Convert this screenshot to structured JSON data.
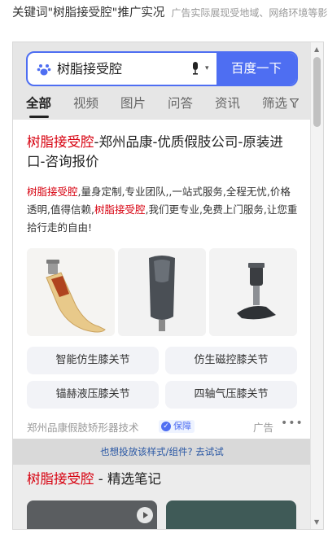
{
  "page": {
    "heading": "关键词\"树脂接受腔\"推广实况",
    "subheading": "广告实际展现受地域、网络环境等影响"
  },
  "search": {
    "query": "树脂接受腔",
    "button_label": "百度一下",
    "icon": "baidu-paw-icon"
  },
  "tabs": [
    {
      "label": "全部",
      "active": true
    },
    {
      "label": "视频"
    },
    {
      "label": "图片"
    },
    {
      "label": "问答"
    },
    {
      "label": "资讯"
    },
    {
      "label": "筛选"
    }
  ],
  "ad": {
    "title_highlight": "树脂接受腔",
    "title_rest": "-郑州品康-优质假肢公司-原装进口-咨询报价",
    "desc_hl1": "树脂接受腔",
    "desc_part1": ",量身定制,专业团队,,一站式服务,全程无忧,价格透明,值得信赖,",
    "desc_hl2": "树脂接受腔",
    "desc_part2": ",我们更专业,免费上门服务,让您重拾行走的自由!",
    "images": [
      "prosthetic-foot-image",
      "prosthetic-socket-image",
      "prosthetic-knee-foot-image"
    ],
    "chips": [
      "智能仿生膝关节",
      "仿生磁控膝关节",
      "锚赫液压膝关节",
      "四轴气压膝关节"
    ],
    "source": "郑州品康假肢矫形器技术",
    "verified_label": "保障",
    "ad_label": "广告",
    "more": "•••"
  },
  "promo": {
    "text": "也想投放该样式/组件? 去试试"
  },
  "notes": {
    "title_highlight": "树脂接受腔",
    "title_rest": " - 精选笔记"
  },
  "colors": {
    "brand_blue": "#4e6ef2",
    "highlight_red": "#d7000f",
    "link_blue": "#2957a4"
  }
}
